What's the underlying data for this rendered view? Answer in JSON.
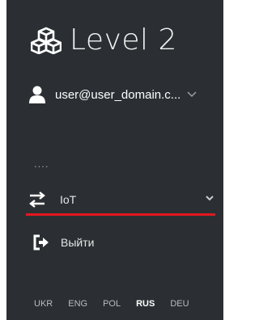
{
  "brand": {
    "name": "Level 2",
    "logo_icon": "cubes-icon"
  },
  "user": {
    "email": "user@user_domain.c...",
    "icon": "user-icon"
  },
  "placeholder": "....",
  "nav": {
    "iot_label": "IoT",
    "iot_icon": "exchange-arrows-icon",
    "accent_color": "#e3181f"
  },
  "logout": {
    "label": "Выйти",
    "icon": "sign-out-icon"
  },
  "languages": {
    "items": [
      "UKR",
      "ENG",
      "POL",
      "RUS",
      "DEU"
    ],
    "active": "RUS"
  }
}
